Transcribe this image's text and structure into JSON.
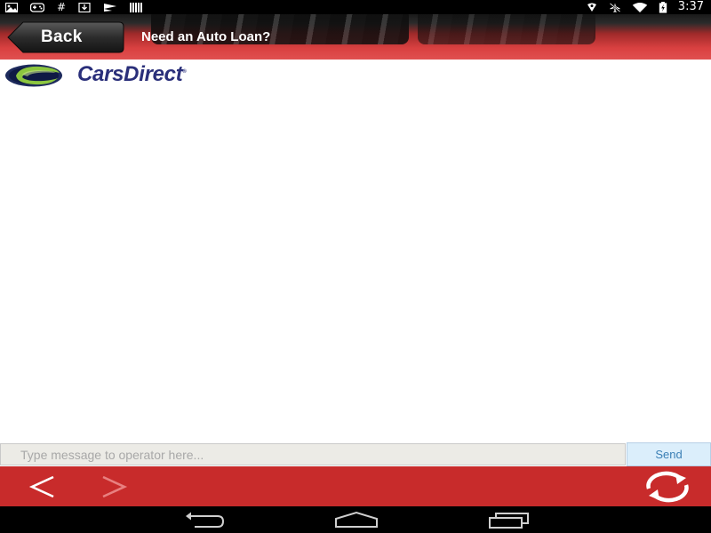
{
  "status_bar": {
    "time": "3:37",
    "left_icons": [
      "photo-icon",
      "gamepad-icon",
      "hash-icon",
      "download-icon",
      "flag-icon",
      "barcode-icon"
    ],
    "right_icons": [
      "location-icon",
      "airplane-icon",
      "wifi-icon",
      "battery-icon"
    ],
    "hash_glyph": "#"
  },
  "header": {
    "back_label": "Back",
    "title": "Need an Auto Loan?"
  },
  "logo": {
    "name": "CarsDirect",
    "name_part1": "Cars",
    "name_part2": "Direct",
    "trademark": "®"
  },
  "message_bar": {
    "placeholder": "Type message to operator here...",
    "value": "",
    "send_label": "Send"
  },
  "toolbar": {
    "icons": [
      "back-arrow-icon",
      "forward-arrow-icon",
      "refresh-icon"
    ]
  },
  "nav_bar": {
    "icons": [
      "nav-back-icon",
      "nav-home-icon",
      "nav-recents-icon"
    ]
  },
  "colors": {
    "header_red": "#e05050",
    "toolbar_red": "#c82b2b",
    "logo_blue": "#2a2f7a",
    "logo_green": "#8cc63f",
    "send_blue": "#3a7fb5"
  }
}
